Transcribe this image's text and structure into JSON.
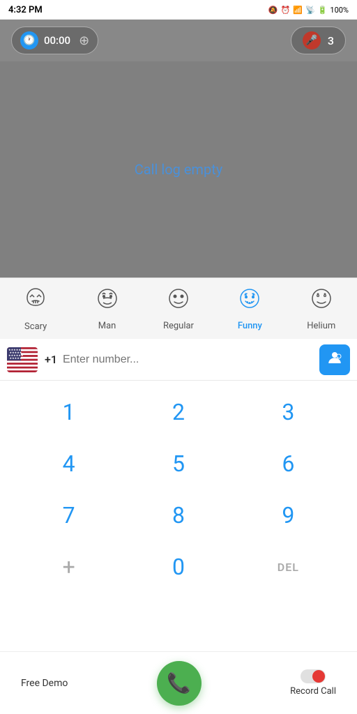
{
  "statusBar": {
    "time": "4:32 PM",
    "batteryPercent": "100%"
  },
  "topBar": {
    "timerValue": "00:00",
    "micCount": "3"
  },
  "callLog": {
    "emptyMessage": "Call log empty"
  },
  "voiceEffects": [
    {
      "id": "scary",
      "label": "Scary",
      "icon": "👻",
      "active": false
    },
    {
      "id": "man",
      "label": "Man",
      "icon": "😶",
      "active": false
    },
    {
      "id": "regular",
      "label": "Regular",
      "icon": "😊",
      "active": false
    },
    {
      "id": "funny",
      "label": "Funny",
      "icon": "🤪",
      "active": true
    },
    {
      "id": "helium",
      "label": "Helium",
      "icon": "😵",
      "active": false
    }
  ],
  "numberInput": {
    "countryCode": "+1",
    "placeholder": "Enter number..."
  },
  "dialpad": {
    "rows": [
      [
        "1",
        "2",
        "3"
      ],
      [
        "4",
        "5",
        "6"
      ],
      [
        "7",
        "8",
        "9"
      ],
      [
        "+",
        "0",
        "DEL"
      ]
    ]
  },
  "bottomBar": {
    "freeDemoLabel": "Free Demo",
    "recordLabel": "Record Call"
  }
}
